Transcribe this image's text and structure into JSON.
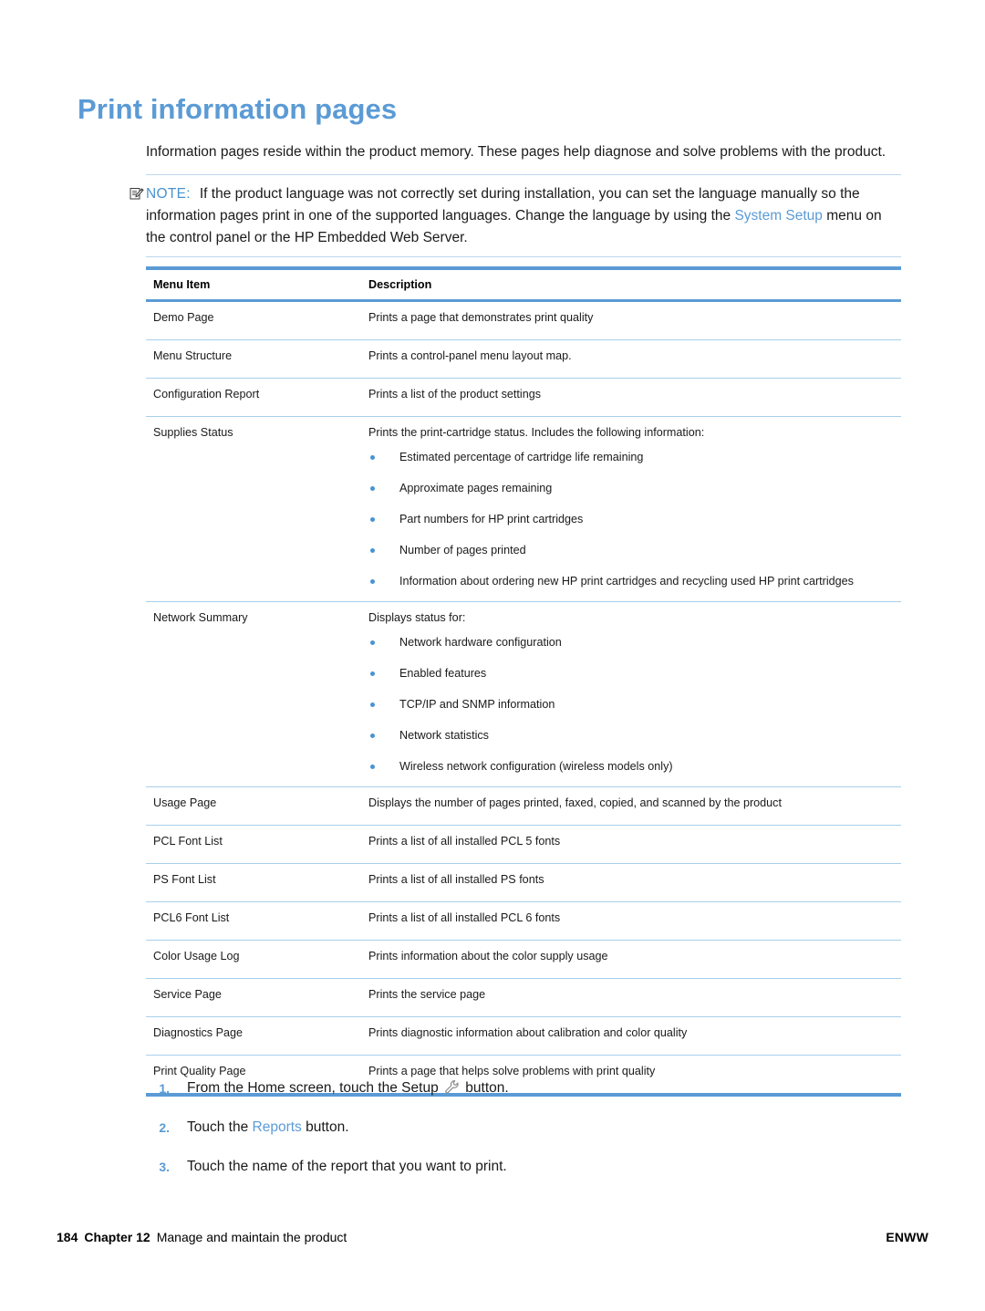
{
  "document": {
    "heading": "Print information pages",
    "intro": "Information pages reside within the product memory. These pages help diagnose and solve problems with the product."
  },
  "note": {
    "icon": "note-pencil-icon",
    "label": "NOTE:",
    "text_part1": "If the product language was not correctly set during installation, you can set the language manually so the information pages print in one of the supported languages. Change the language by using the ",
    "link": "System Setup",
    "text_part2": " menu on the control panel or the HP Embedded Web Server."
  },
  "table": {
    "headers": {
      "menu_item": "Menu Item",
      "description": "Description"
    },
    "rows": [
      {
        "menu_item": "Demo Page",
        "description": "Prints a page that demonstrates print quality",
        "bullets": []
      },
      {
        "menu_item": "Menu Structure",
        "description": "Prints a control-panel menu layout map.",
        "bullets": []
      },
      {
        "menu_item": "Configuration Report",
        "description": "Prints a list of the product settings",
        "bullets": []
      },
      {
        "menu_item": "Supplies Status",
        "description": "Prints the print-cartridge status. Includes the following information:",
        "bullets": [
          "Estimated percentage of cartridge life remaining",
          "Approximate pages remaining",
          "Part numbers for HP print cartridges",
          "Number of pages printed",
          "Information about ordering new HP print cartridges and recycling used HP print cartridges"
        ]
      },
      {
        "menu_item": "Network Summary",
        "description": "Displays status for:",
        "bullets": [
          "Network hardware configuration",
          "Enabled features",
          "TCP/IP and SNMP information",
          "Network statistics",
          "Wireless network configuration (wireless models only)"
        ]
      },
      {
        "menu_item": "Usage Page",
        "description": "Displays the number of pages printed, faxed, copied, and scanned by the product",
        "bullets": []
      },
      {
        "menu_item": "PCL Font List",
        "description": "Prints a list of all installed PCL 5 fonts",
        "bullets": []
      },
      {
        "menu_item": "PS Font List",
        "description": "Prints a list of all installed PS fonts",
        "bullets": []
      },
      {
        "menu_item": "PCL6 Font List",
        "description": "Prints a list of all installed PCL 6 fonts",
        "bullets": []
      },
      {
        "menu_item": "Color Usage Log",
        "description": "Prints information about the color supply usage",
        "bullets": []
      },
      {
        "menu_item": "Service Page",
        "description": "Prints the service page",
        "bullets": []
      },
      {
        "menu_item": "Diagnostics Page",
        "description": "Prints diagnostic information about calibration and color quality",
        "bullets": []
      },
      {
        "menu_item": "Print Quality Page",
        "description": "Prints a page that helps solve problems with print quality",
        "bullets": []
      }
    ]
  },
  "steps": [
    {
      "number": "1.",
      "text_part1": "From the Home screen, touch the Setup ",
      "icon": "wrench-icon",
      "text_part2": " button."
    },
    {
      "number": "2.",
      "text_part1": "Touch the ",
      "link": "Reports",
      "text_part2": " button."
    },
    {
      "number": "3.",
      "text_part1": "Touch the name of the report that you want to print.",
      "text_part2": ""
    }
  ],
  "footer": {
    "page_number": "184",
    "chapter": "Chapter 12",
    "chapter_title": "Manage and maintain the product",
    "locale": "ENWW"
  },
  "colors": {
    "accent_blue": "#5b9bd5",
    "rule_blue": "#a9cfea",
    "text_black": "#1a1a1a"
  }
}
